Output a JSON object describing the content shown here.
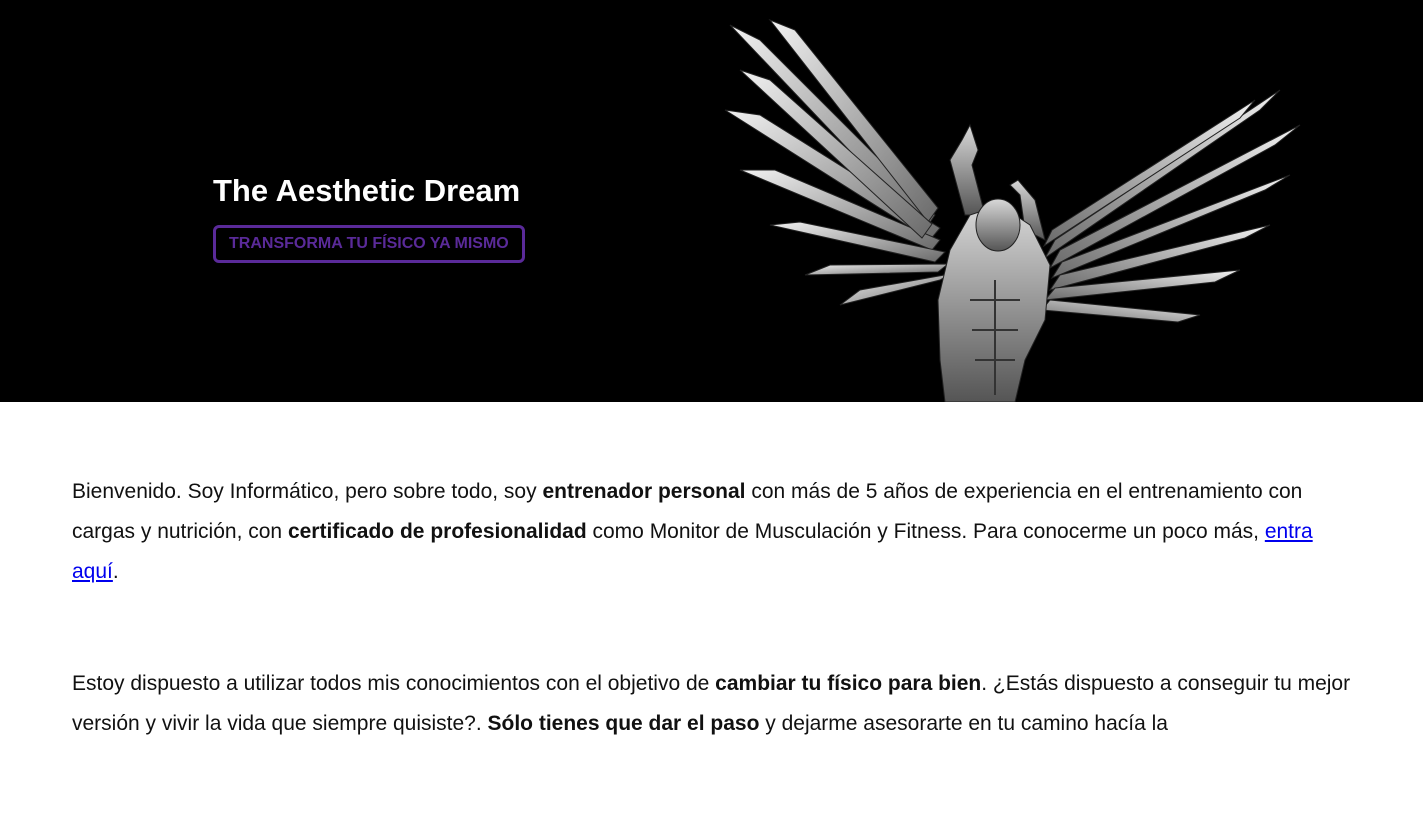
{
  "hero": {
    "title": "The Aesthetic Dream",
    "cta_label": "TRANSFORMA TU FÍSICO YA MISMO",
    "accent_color": "#5a2a99",
    "background_color": "#000000",
    "image_subject": "winged-muscular-man-illustration"
  },
  "intro": {
    "p1_a": "Bienvenido. Soy Informático, pero sobre todo, soy ",
    "p1_b": "entrenador personal",
    "p1_c": " con más de 5 años de experiencia en el entrenamiento con cargas y nutrición, con ",
    "p1_d": "certificado de profesionalidad",
    "p1_e": " como Monitor de Musculación y Fitness. Para conocerme un poco más, ",
    "p1_link": "entra aquí",
    "p1_f": ".",
    "p2_a": "Estoy dispuesto a utilizar todos mis conocimientos con el objetivo de ",
    "p2_b": "cambiar tu físico para bien",
    "p2_c": ". ¿Estás dispuesto a conseguir tu mejor versión y vivir la vida que siempre quisiste?. ",
    "p2_d": "Sólo tienes que dar el paso",
    "p2_e": " y dejarme asesorarte en tu camino hacía la"
  }
}
